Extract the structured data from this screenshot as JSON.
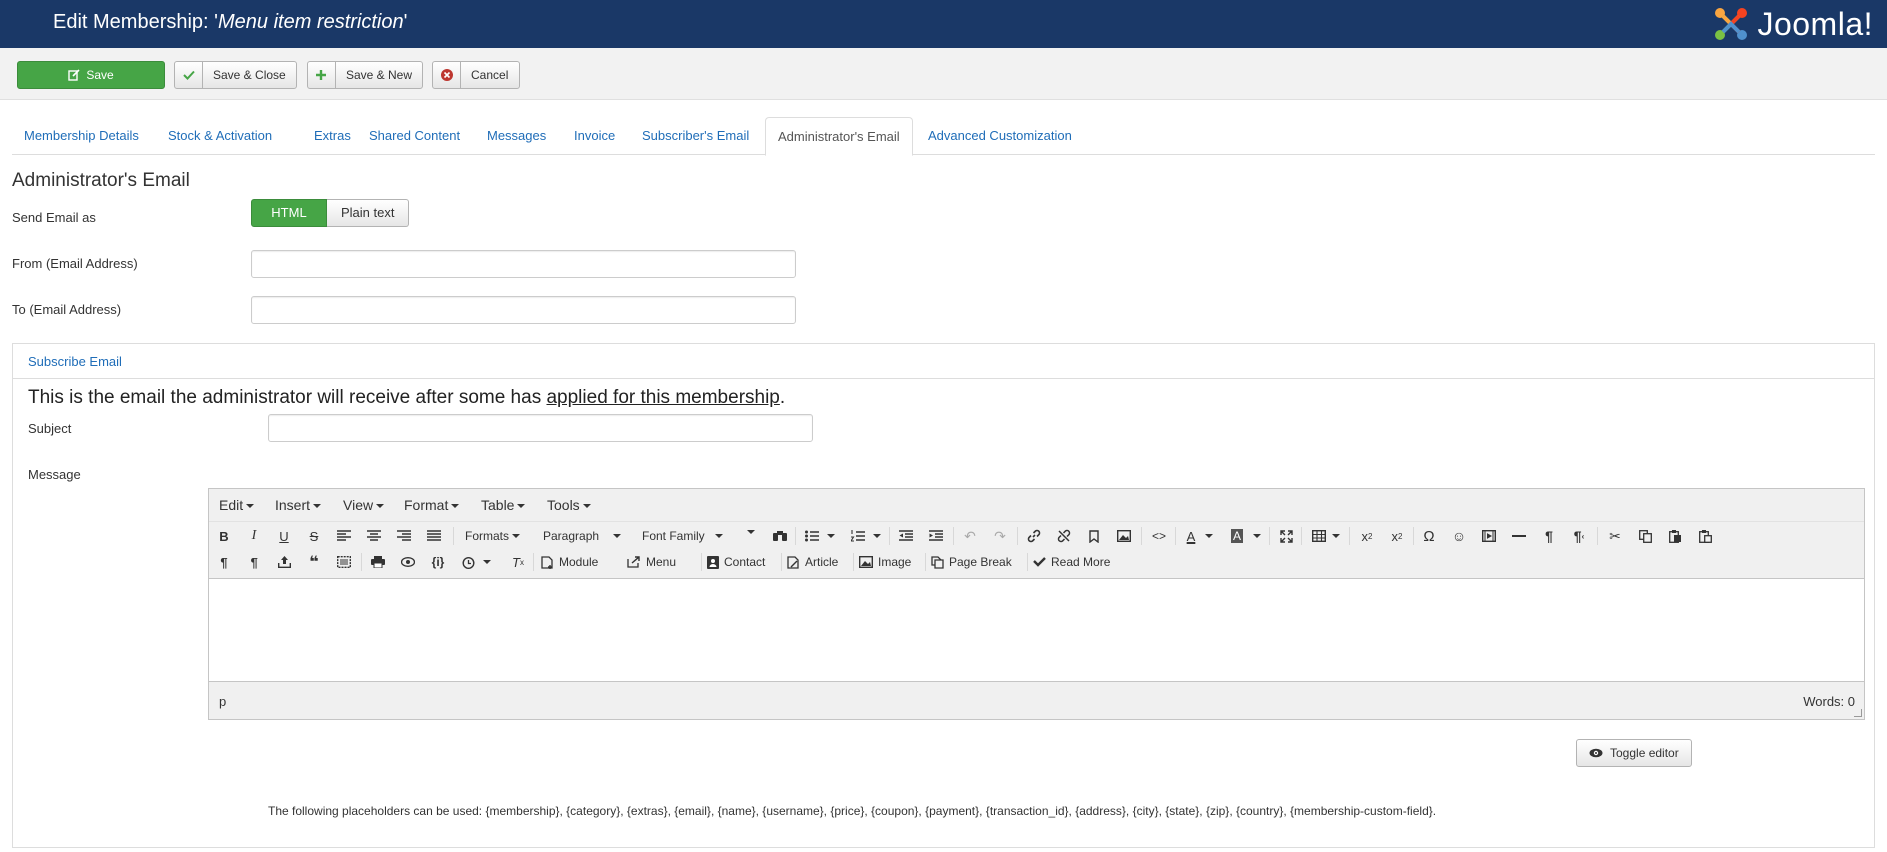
{
  "header": {
    "title_prefix": "Edit Membership: '",
    "title_name": "Menu item restriction",
    "title_suffix": "'",
    "brand": "Joomla!"
  },
  "toolbar": {
    "save": "Save",
    "save_close": "Save & Close",
    "save_new": "Save & New",
    "cancel": "Cancel"
  },
  "tabs": [
    {
      "label": "Membership Details"
    },
    {
      "label": "Stock & Activation"
    },
    {
      "label": "Extras"
    },
    {
      "label": "Shared Content"
    },
    {
      "label": "Messages"
    },
    {
      "label": "Invoice"
    },
    {
      "label": "Subscriber's Email"
    },
    {
      "label": "Administrator's Email",
      "active": true
    },
    {
      "label": "Advanced Customization"
    }
  ],
  "section": {
    "title": "Administrator's Email",
    "send_as_label": "Send Email as",
    "send_as_options": [
      "HTML",
      "Plain text"
    ],
    "send_as_selected": "HTML",
    "from_label": "From (Email Address)",
    "from_value": "",
    "to_label": "To (Email Address)",
    "to_value": ""
  },
  "panel": {
    "title": "Subscribe Email",
    "intro_before": "This is the email the administrator will receive after some has ",
    "intro_link": "applied for this membership",
    "intro_after": ".",
    "subject_label": "Subject",
    "subject_value": "",
    "message_label": "Message"
  },
  "editor": {
    "menus": [
      "Edit",
      "Insert",
      "View",
      "Format",
      "Table",
      "Tools"
    ],
    "formats": "Formats",
    "block": "Paragraph",
    "font_family": "Font Family",
    "buttons": {
      "module": "Module",
      "menu": "Menu",
      "contact": "Contact",
      "article": "Article",
      "image": "Image",
      "page_break": "Page Break",
      "read_more": "Read More"
    },
    "path": "p",
    "word_count": "Words: 0",
    "toggle": "Toggle editor"
  },
  "placeholders_text": "The following placeholders can be used: {membership}, {category}, {extras}, {email}, {name}, {username}, {price}, {coupon}, {payment}, {transaction_id}, {address}, {city}, {state}, {zip}, {country}, {membership-custom-field}.",
  "colors": {
    "header_bg": "#1a3867",
    "success": "#46a546",
    "link": "#1f6db8",
    "danger": "#bd362f"
  }
}
